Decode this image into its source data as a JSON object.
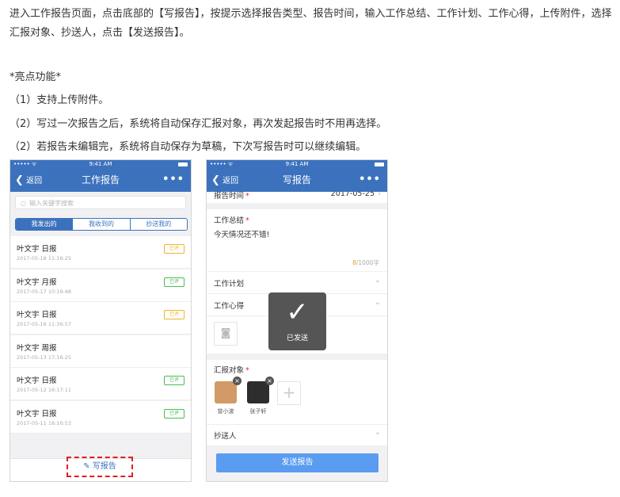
{
  "article": {
    "intro": "进入工作报告页面，点击底部的【写报告】，按提示选择报告类型、报告时间，输入工作总结、工作计划、工作心得，上传附件，选择汇报对象、抄送人，点击【发送报告】。",
    "highlight_heading": "*亮点功能*",
    "features": [
      "（1）支持上传附件。",
      "（2）写过一次报告之后，系统将自动保存汇报对象，再次发起报告时不用再选择。",
      "（2）若报告未编辑完，系统将自动保存为草稿，下次写报告时可以继续编辑。"
    ]
  },
  "left_phone": {
    "status": {
      "signal": "••••• ᯤ",
      "time": "9:41 AM"
    },
    "nav": {
      "back": "返回",
      "title": "工作报告",
      "more": "•••"
    },
    "search_placeholder": "输入关键字搜索",
    "tabs": [
      "我发出的",
      "我收到的",
      "抄送我的"
    ],
    "reports": [
      {
        "title": "叶文宇 日报",
        "date": "2017-05-18 11:16:25",
        "tag": "已评",
        "tag_color": "#f0b429"
      },
      {
        "title": "叶文宇 月报",
        "date": "2017-05-17 10:19:48",
        "tag": "已评",
        "tag_color": "#4cbb53"
      },
      {
        "title": "叶文宇 日报",
        "date": "2017-05-16 11:36:57",
        "tag": "已评",
        "tag_color": "#f0b429"
      },
      {
        "title": "叶文宇 周报",
        "date": "2017-05-13 17:16:25",
        "tag": "",
        "tag_color": ""
      },
      {
        "title": "叶文宇 日报",
        "date": "2017-05-12 16:17:11",
        "tag": "已评",
        "tag_color": "#4cbb53"
      },
      {
        "title": "叶文宇 日报",
        "date": "2017-05-11 18:10:53",
        "tag": "已评",
        "tag_color": "#4cbb53"
      }
    ],
    "write_button": "写报告"
  },
  "right_phone": {
    "status": {
      "signal": "••••• ᯤ",
      "time": "9:41 AM"
    },
    "nav": {
      "back": "返回",
      "title": "写报告",
      "more": "•••"
    },
    "report_time_label": "报告时间",
    "report_time_value": "2017-05-25",
    "summary_label": "工作总结",
    "summary_text": "今天情况还不错!",
    "char_count": "8",
    "char_limit": "/1000字",
    "plan_label": "工作计划",
    "experience_label": "工作心得",
    "toast": "已发送",
    "recipients_label": "汇报对象",
    "recipients": [
      "曾小波",
      "张子轩"
    ],
    "cc_label": "抄送人",
    "send_button": "发送报告"
  },
  "colors": {
    "brand": "#3c72bd",
    "send": "#5a9cf0",
    "highlight": "#e02020",
    "required": "#e22233"
  }
}
